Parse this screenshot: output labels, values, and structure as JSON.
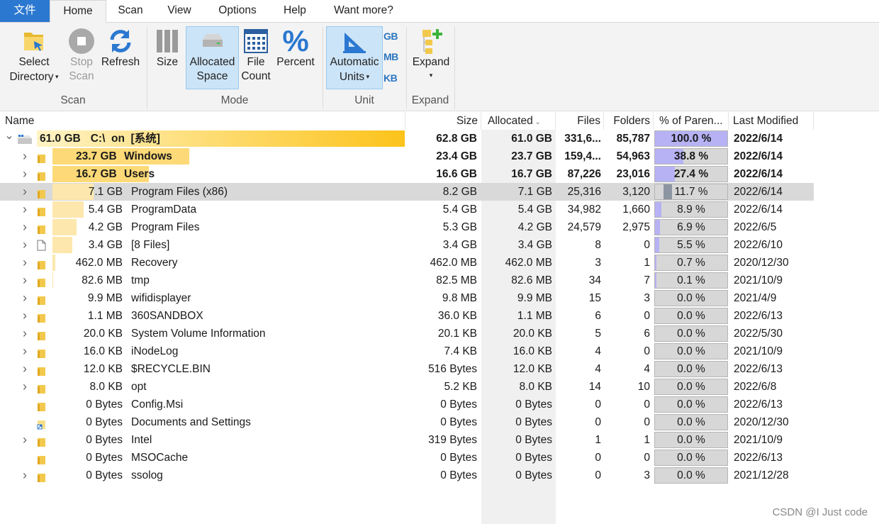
{
  "tabs": [
    "文件",
    "Home",
    "Scan",
    "View",
    "Options",
    "Help",
    "Want more?"
  ],
  "ribbon": {
    "select_directory": [
      "Select",
      "Directory"
    ],
    "stop_scan": [
      "Stop",
      "Scan"
    ],
    "refresh": "Refresh",
    "scan_group": "Scan",
    "size": "Size",
    "allocated_space": [
      "Allocated",
      "Space"
    ],
    "file_count": [
      "File",
      "Count"
    ],
    "percent": "Percent",
    "mode_group": "Mode",
    "automatic_units": [
      "Automatic",
      "Units"
    ],
    "unit_gb": "GB",
    "unit_mb": "MB",
    "unit_kb": "KB",
    "unit_group": "Unit",
    "expand": "Expand",
    "expand_group": "Expand"
  },
  "columns": [
    "Name",
    "Size",
    "Allocated",
    "Files",
    "Folders",
    "% of Paren...",
    "Last Modified"
  ],
  "rows": [
    {
      "level": 0,
      "expander": "expanded",
      "icon": "drive",
      "bold": true,
      "size_label": "61.0 GB",
      "name": "C:\\  on  [系统]",
      "size": "62.8 GB",
      "allocated": "61.0 GB",
      "files": "331,6...",
      "folders": "85,787",
      "percent": "100.0 %",
      "pct_value": 100,
      "modified": "2022/6/14"
    },
    {
      "level": 1,
      "expander": "collapsed",
      "icon": "folder",
      "bold": true,
      "size_label": "23.7 GB",
      "name": "Windows",
      "size": "23.4 GB",
      "allocated": "23.7 GB",
      "files": "159,4...",
      "folders": "54,963",
      "percent": "38.8 %",
      "pct_value": 38.8,
      "modified": "2022/6/14"
    },
    {
      "level": 1,
      "expander": "collapsed",
      "icon": "folder",
      "bold": true,
      "size_label": "16.7 GB",
      "name": "Users",
      "size": "16.6 GB",
      "allocated": "16.7 GB",
      "files": "87,226",
      "folders": "23,016",
      "percent": "27.4 %",
      "pct_value": 27.4,
      "modified": "2022/6/14"
    },
    {
      "level": 1,
      "expander": "collapsed",
      "icon": "folder",
      "bold": false,
      "selected": true,
      "size_label": "7.1 GB",
      "name": "Program Files (x86)",
      "size": "8.2 GB",
      "allocated": "7.1 GB",
      "files": "25,316",
      "folders": "3,120",
      "percent": "11.7 %",
      "pct_value": 11.7,
      "modified": "2022/6/14"
    },
    {
      "level": 1,
      "expander": "collapsed",
      "icon": "folder",
      "bold": false,
      "size_label": "5.4 GB",
      "name": "ProgramData",
      "size": "5.4 GB",
      "allocated": "5.4 GB",
      "files": "34,982",
      "folders": "1,660",
      "percent": "8.9 %",
      "pct_value": 8.9,
      "modified": "2022/6/14"
    },
    {
      "level": 1,
      "expander": "collapsed",
      "icon": "folder",
      "bold": false,
      "size_label": "4.2 GB",
      "name": "Program Files",
      "size": "5.3 GB",
      "allocated": "4.2 GB",
      "files": "24,579",
      "folders": "2,975",
      "percent": "6.9 %",
      "pct_value": 6.9,
      "modified": "2022/6/5"
    },
    {
      "level": 1,
      "expander": "collapsed",
      "icon": "file",
      "bold": false,
      "size_label": "3.4 GB",
      "name": "[8 Files]",
      "size": "3.4 GB",
      "allocated": "3.4 GB",
      "files": "8",
      "folders": "0",
      "percent": "5.5 %",
      "pct_value": 5.5,
      "modified": "2022/6/10"
    },
    {
      "level": 1,
      "expander": "collapsed",
      "icon": "folder",
      "bold": false,
      "size_label": "462.0 MB",
      "name": "Recovery",
      "size": "462.0 MB",
      "allocated": "462.0 MB",
      "files": "3",
      "folders": "1",
      "percent": "0.7 %",
      "pct_value": 0.7,
      "modified": "2020/12/30"
    },
    {
      "level": 1,
      "expander": "collapsed",
      "icon": "folder",
      "bold": false,
      "size_label": "82.6 MB",
      "name": "tmp",
      "size": "82.5 MB",
      "allocated": "82.6 MB",
      "files": "34",
      "folders": "7",
      "percent": "0.1 %",
      "pct_value": 0.1,
      "modified": "2021/10/9"
    },
    {
      "level": 1,
      "expander": "collapsed",
      "icon": "folder",
      "bold": false,
      "size_label": "9.9 MB",
      "name": "wifidisplayer",
      "size": "9.8 MB",
      "allocated": "9.9 MB",
      "files": "15",
      "folders": "3",
      "percent": "0.0 %",
      "pct_value": 0,
      "modified": "2021/4/9"
    },
    {
      "level": 1,
      "expander": "collapsed",
      "icon": "folder",
      "bold": false,
      "size_label": "1.1 MB",
      "name": "360SANDBOX",
      "size": "36.0 KB",
      "allocated": "1.1 MB",
      "files": "6",
      "folders": "0",
      "percent": "0.0 %",
      "pct_value": 0,
      "modified": "2022/6/13"
    },
    {
      "level": 1,
      "expander": "collapsed",
      "icon": "folder",
      "bold": false,
      "size_label": "20.0 KB",
      "name": "System Volume Information",
      "size": "20.1 KB",
      "allocated": "20.0 KB",
      "files": "5",
      "folders": "6",
      "percent": "0.0 %",
      "pct_value": 0,
      "modified": "2022/5/30"
    },
    {
      "level": 1,
      "expander": "collapsed",
      "icon": "folder",
      "bold": false,
      "size_label": "16.0 KB",
      "name": "iNodeLog",
      "size": "7.4 KB",
      "allocated": "16.0 KB",
      "files": "4",
      "folders": "0",
      "percent": "0.0 %",
      "pct_value": 0,
      "modified": "2021/10/9"
    },
    {
      "level": 1,
      "expander": "collapsed",
      "icon": "folder",
      "bold": false,
      "size_label": "12.0 KB",
      "name": "$RECYCLE.BIN",
      "size": "516 Bytes",
      "allocated": "12.0 KB",
      "files": "4",
      "folders": "4",
      "percent": "0.0 %",
      "pct_value": 0,
      "modified": "2022/6/13"
    },
    {
      "level": 1,
      "expander": "collapsed",
      "icon": "folder",
      "bold": false,
      "size_label": "8.0 KB",
      "name": "opt",
      "size": "5.2 KB",
      "allocated": "8.0 KB",
      "files": "14",
      "folders": "10",
      "percent": "0.0 %",
      "pct_value": 0,
      "modified": "2022/6/8"
    },
    {
      "level": 1,
      "expander": "none",
      "icon": "folder",
      "bold": false,
      "size_label": "0 Bytes",
      "name": "Config.Msi",
      "size": "0 Bytes",
      "allocated": "0 Bytes",
      "files": "0",
      "folders": "0",
      "percent": "0.0 %",
      "pct_value": 0,
      "modified": "2022/6/13"
    },
    {
      "level": 1,
      "expander": "none",
      "icon": "shortcut",
      "bold": false,
      "size_label": "0 Bytes",
      "name": "Documents and Settings",
      "size": "0 Bytes",
      "allocated": "0 Bytes",
      "files": "0",
      "folders": "0",
      "percent": "0.0 %",
      "pct_value": 0,
      "modified": "2020/12/30"
    },
    {
      "level": 1,
      "expander": "collapsed",
      "icon": "folder",
      "bold": false,
      "size_label": "0 Bytes",
      "name": "Intel",
      "size": "319 Bytes",
      "allocated": "0 Bytes",
      "files": "1",
      "folders": "1",
      "percent": "0.0 %",
      "pct_value": 0,
      "modified": "2021/10/9"
    },
    {
      "level": 1,
      "expander": "none",
      "icon": "folder",
      "bold": false,
      "size_label": "0 Bytes",
      "name": "MSOCache",
      "size": "0 Bytes",
      "allocated": "0 Bytes",
      "files": "0",
      "folders": "0",
      "percent": "0.0 %",
      "pct_value": 0,
      "modified": "2022/6/13"
    },
    {
      "level": 1,
      "expander": "collapsed",
      "icon": "folder",
      "bold": false,
      "size_label": "0 Bytes",
      "name": "ssolog",
      "size": "0 Bytes",
      "allocated": "0 Bytes",
      "files": "0",
      "folders": "3",
      "percent": "0.0 %",
      "pct_value": 0,
      "modified": "2021/12/28"
    }
  ],
  "watermark": "CSDN @I Just code"
}
